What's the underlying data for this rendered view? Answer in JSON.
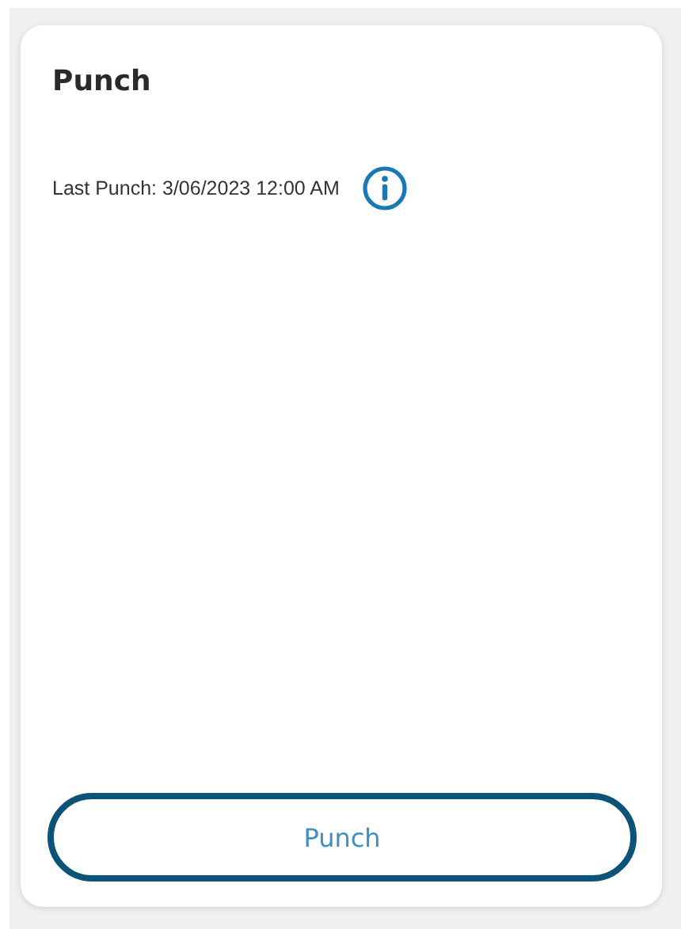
{
  "card": {
    "title": "Punch",
    "last_punch": "Last Punch: 3/06/2023 12:00 AM",
    "button": "Punch"
  }
}
